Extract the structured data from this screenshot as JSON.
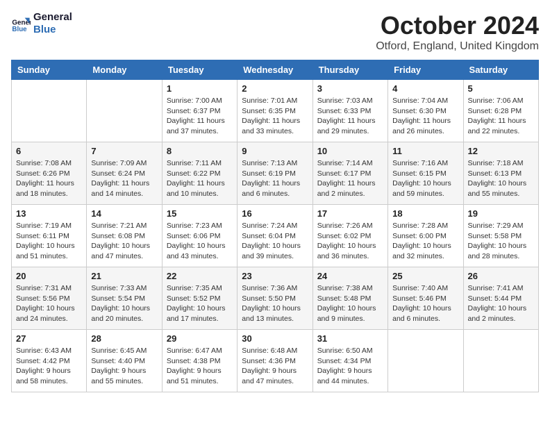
{
  "header": {
    "logo_line1": "General",
    "logo_line2": "Blue",
    "month_title": "October 2024",
    "location": "Otford, England, United Kingdom"
  },
  "weekdays": [
    "Sunday",
    "Monday",
    "Tuesday",
    "Wednesday",
    "Thursday",
    "Friday",
    "Saturday"
  ],
  "weeks": [
    [
      {
        "day": "",
        "info": ""
      },
      {
        "day": "",
        "info": ""
      },
      {
        "day": "1",
        "info": "Sunrise: 7:00 AM\nSunset: 6:37 PM\nDaylight: 11 hours\nand 37 minutes."
      },
      {
        "day": "2",
        "info": "Sunrise: 7:01 AM\nSunset: 6:35 PM\nDaylight: 11 hours\nand 33 minutes."
      },
      {
        "day": "3",
        "info": "Sunrise: 7:03 AM\nSunset: 6:33 PM\nDaylight: 11 hours\nand 29 minutes."
      },
      {
        "day": "4",
        "info": "Sunrise: 7:04 AM\nSunset: 6:30 PM\nDaylight: 11 hours\nand 26 minutes."
      },
      {
        "day": "5",
        "info": "Sunrise: 7:06 AM\nSunset: 6:28 PM\nDaylight: 11 hours\nand 22 minutes."
      }
    ],
    [
      {
        "day": "6",
        "info": "Sunrise: 7:08 AM\nSunset: 6:26 PM\nDaylight: 11 hours\nand 18 minutes."
      },
      {
        "day": "7",
        "info": "Sunrise: 7:09 AM\nSunset: 6:24 PM\nDaylight: 11 hours\nand 14 minutes."
      },
      {
        "day": "8",
        "info": "Sunrise: 7:11 AM\nSunset: 6:22 PM\nDaylight: 11 hours\nand 10 minutes."
      },
      {
        "day": "9",
        "info": "Sunrise: 7:13 AM\nSunset: 6:19 PM\nDaylight: 11 hours\nand 6 minutes."
      },
      {
        "day": "10",
        "info": "Sunrise: 7:14 AM\nSunset: 6:17 PM\nDaylight: 11 hours\nand 2 minutes."
      },
      {
        "day": "11",
        "info": "Sunrise: 7:16 AM\nSunset: 6:15 PM\nDaylight: 10 hours\nand 59 minutes."
      },
      {
        "day": "12",
        "info": "Sunrise: 7:18 AM\nSunset: 6:13 PM\nDaylight: 10 hours\nand 55 minutes."
      }
    ],
    [
      {
        "day": "13",
        "info": "Sunrise: 7:19 AM\nSunset: 6:11 PM\nDaylight: 10 hours\nand 51 minutes."
      },
      {
        "day": "14",
        "info": "Sunrise: 7:21 AM\nSunset: 6:08 PM\nDaylight: 10 hours\nand 47 minutes."
      },
      {
        "day": "15",
        "info": "Sunrise: 7:23 AM\nSunset: 6:06 PM\nDaylight: 10 hours\nand 43 minutes."
      },
      {
        "day": "16",
        "info": "Sunrise: 7:24 AM\nSunset: 6:04 PM\nDaylight: 10 hours\nand 39 minutes."
      },
      {
        "day": "17",
        "info": "Sunrise: 7:26 AM\nSunset: 6:02 PM\nDaylight: 10 hours\nand 36 minutes."
      },
      {
        "day": "18",
        "info": "Sunrise: 7:28 AM\nSunset: 6:00 PM\nDaylight: 10 hours\nand 32 minutes."
      },
      {
        "day": "19",
        "info": "Sunrise: 7:29 AM\nSunset: 5:58 PM\nDaylight: 10 hours\nand 28 minutes."
      }
    ],
    [
      {
        "day": "20",
        "info": "Sunrise: 7:31 AM\nSunset: 5:56 PM\nDaylight: 10 hours\nand 24 minutes."
      },
      {
        "day": "21",
        "info": "Sunrise: 7:33 AM\nSunset: 5:54 PM\nDaylight: 10 hours\nand 20 minutes."
      },
      {
        "day": "22",
        "info": "Sunrise: 7:35 AM\nSunset: 5:52 PM\nDaylight: 10 hours\nand 17 minutes."
      },
      {
        "day": "23",
        "info": "Sunrise: 7:36 AM\nSunset: 5:50 PM\nDaylight: 10 hours\nand 13 minutes."
      },
      {
        "day": "24",
        "info": "Sunrise: 7:38 AM\nSunset: 5:48 PM\nDaylight: 10 hours\nand 9 minutes."
      },
      {
        "day": "25",
        "info": "Sunrise: 7:40 AM\nSunset: 5:46 PM\nDaylight: 10 hours\nand 6 minutes."
      },
      {
        "day": "26",
        "info": "Sunrise: 7:41 AM\nSunset: 5:44 PM\nDaylight: 10 hours\nand 2 minutes."
      }
    ],
    [
      {
        "day": "27",
        "info": "Sunrise: 6:43 AM\nSunset: 4:42 PM\nDaylight: 9 hours\nand 58 minutes."
      },
      {
        "day": "28",
        "info": "Sunrise: 6:45 AM\nSunset: 4:40 PM\nDaylight: 9 hours\nand 55 minutes."
      },
      {
        "day": "29",
        "info": "Sunrise: 6:47 AM\nSunset: 4:38 PM\nDaylight: 9 hours\nand 51 minutes."
      },
      {
        "day": "30",
        "info": "Sunrise: 6:48 AM\nSunset: 4:36 PM\nDaylight: 9 hours\nand 47 minutes."
      },
      {
        "day": "31",
        "info": "Sunrise: 6:50 AM\nSunset: 4:34 PM\nDaylight: 9 hours\nand 44 minutes."
      },
      {
        "day": "",
        "info": ""
      },
      {
        "day": "",
        "info": ""
      }
    ]
  ]
}
